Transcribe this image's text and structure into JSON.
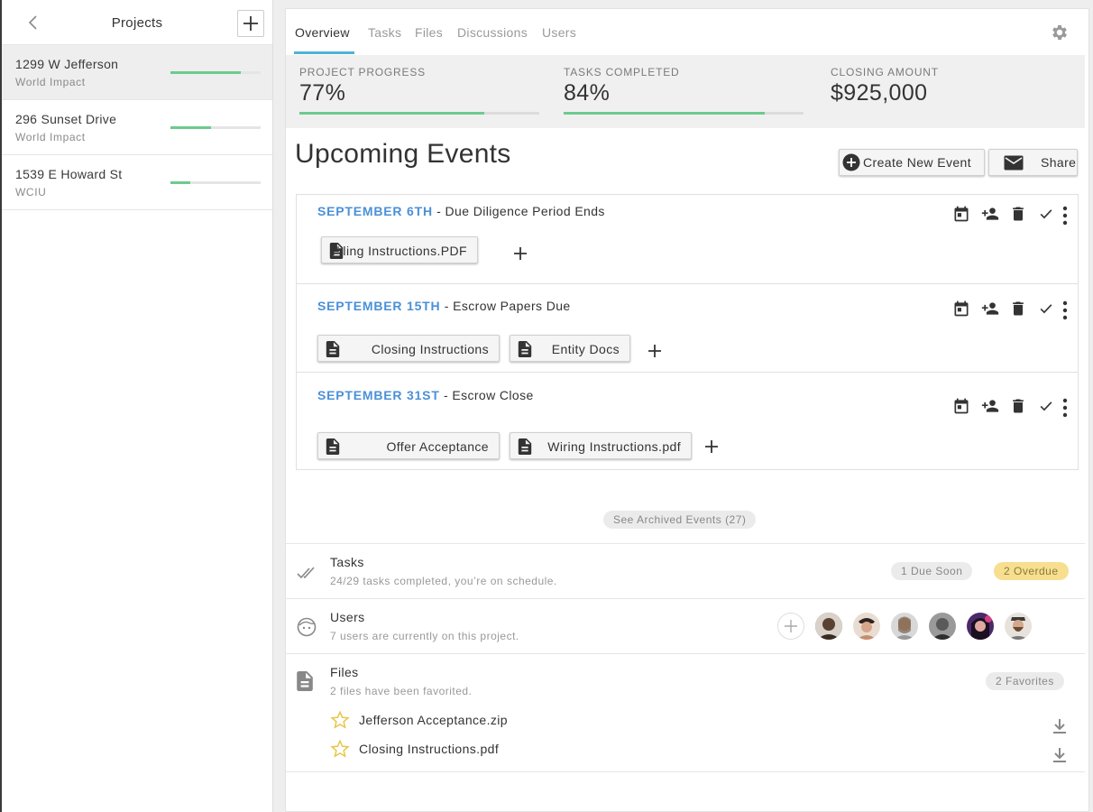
{
  "sidebar": {
    "title": "Projects",
    "projects": [
      {
        "name": "1299 W Jefferson",
        "org": "World Impact",
        "progress": 0.78
      },
      {
        "name": "296 Sunset Drive",
        "org": "World Impact",
        "progress": 0.45
      },
      {
        "name": "1539 E Howard St",
        "org": "WCIU",
        "progress": 0.22
      }
    ]
  },
  "tabs": [
    "Overview",
    "Tasks",
    "Files",
    "Discussions",
    "Users"
  ],
  "stats": [
    {
      "label": "PROJECT PROGRESS",
      "value": "77%",
      "progress": 0.77
    },
    {
      "label": "TASKS COMPLETED",
      "value": "84%",
      "progress": 0.84
    },
    {
      "label": "CLOSING AMOUNT",
      "value": "$925,000"
    }
  ],
  "events_section": {
    "title": "Upcoming Events",
    "create_label": "Create New Event",
    "share_label": "Share",
    "archived_label": "See Archived Events (27)"
  },
  "events": [
    {
      "date": "SEPTEMBER 6TH",
      "title": " - Due Diligence Period Ends",
      "files": [
        "Filing Instructions.PDF"
      ]
    },
    {
      "date": "SEPTEMBER 15TH",
      "title": " - Escrow Papers Due",
      "files": [
        "Closing Instructions",
        "Entity Docs"
      ]
    },
    {
      "date": "SEPTEMBER 31ST",
      "title": " - Escrow Close",
      "files": [
        "Offer Acceptance",
        "Wiring Instructions.pdf"
      ]
    }
  ],
  "tasks": {
    "title": "Tasks",
    "subtitle": "24/29 tasks completed, you’re on schedule.",
    "due_soon": "1 Due Soon",
    "overdue": "2 Overdue"
  },
  "users": {
    "title": "Users",
    "subtitle": "7 users are currently on this project."
  },
  "files": {
    "title": "Files",
    "subtitle": "2 files have been favorited.",
    "favorites_label": "2 Favorites",
    "favorites": [
      "Jefferson Acceptance.zip",
      "Closing Instructions.pdf"
    ]
  },
  "colors": {
    "accent": "#4a90d9",
    "progress": "#6ccb8d",
    "tab_underline": "#4fb3d8",
    "warning": "#f7df8f",
    "star": "#e8c547"
  }
}
